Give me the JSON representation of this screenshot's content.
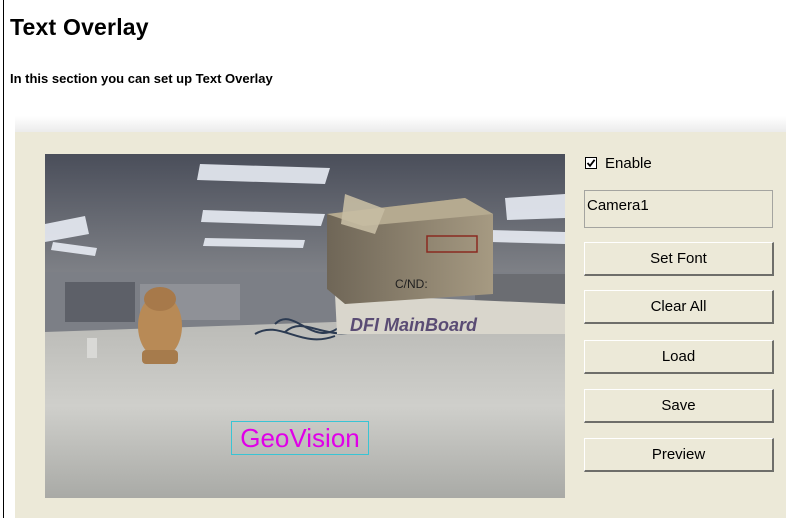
{
  "page": {
    "title": "Text Overlay",
    "description": "In this section you can set up Text Overlay"
  },
  "preview": {
    "overlay_text": "GeoVision",
    "scene_box_label": "C/ND:",
    "scene_board_label": "DFI MainBoard"
  },
  "controls": {
    "enable_label": "Enable",
    "enable_checked": true,
    "camera_name": "Camera1",
    "buttons": {
      "set_font": "Set Font",
      "clear_all": "Clear All",
      "load": "Load",
      "save": "Save",
      "preview": "Preview"
    }
  },
  "colors": {
    "panel_bg": "#ece9d8",
    "overlay_text": "#e000e8",
    "overlay_border": "#39c4d4"
  }
}
